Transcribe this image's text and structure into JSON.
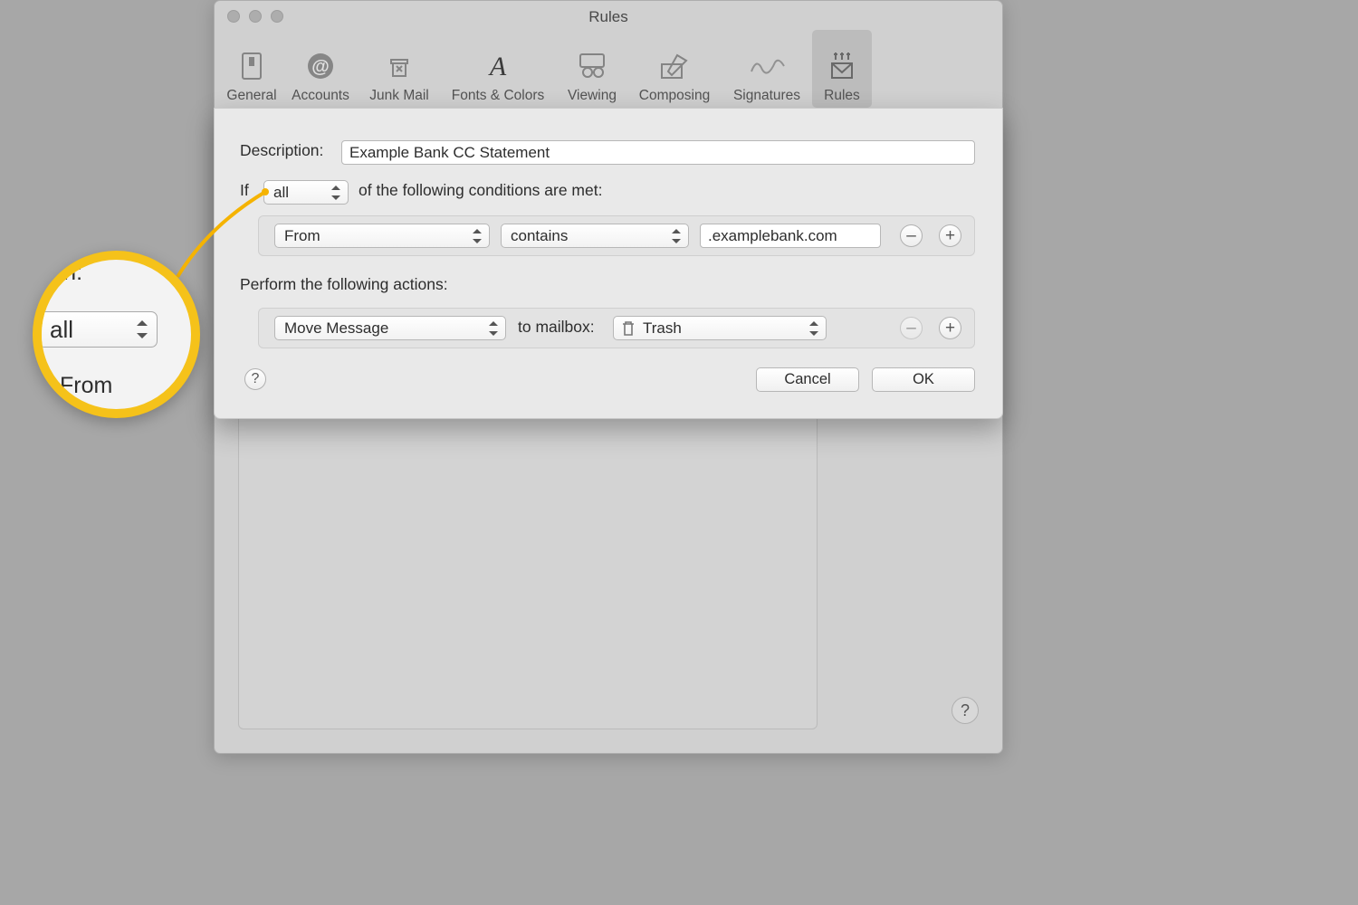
{
  "window": {
    "title": "Rules",
    "toolbar": [
      {
        "label": "General"
      },
      {
        "label": "Accounts"
      },
      {
        "label": "Junk Mail"
      },
      {
        "label": "Fonts & Colors"
      },
      {
        "label": "Viewing"
      },
      {
        "label": "Composing"
      },
      {
        "label": "Signatures"
      },
      {
        "label": "Rules"
      }
    ],
    "selected_toolbar_index": 7,
    "help_glyph": "?"
  },
  "sheet": {
    "description_label": "Description:",
    "description_value": "Example Bank CC Statement",
    "if_prefix": "If",
    "match_mode": "all",
    "if_suffix": "of the following conditions are met:",
    "condition": {
      "field": "From",
      "operator": "contains",
      "value": ".examplebank.com"
    },
    "actions_label": "Perform the following actions:",
    "action": {
      "verb": "Move Message",
      "mid_label": "to mailbox:",
      "mailbox": "Trash"
    },
    "minus_glyph": "–",
    "plus_glyph": "+",
    "help_glyph": "?",
    "cancel_label": "Cancel",
    "ok_label": "OK"
  },
  "callout": {
    "description_fragment": "ription:",
    "match_mode": "all",
    "from_fragment": "From"
  }
}
